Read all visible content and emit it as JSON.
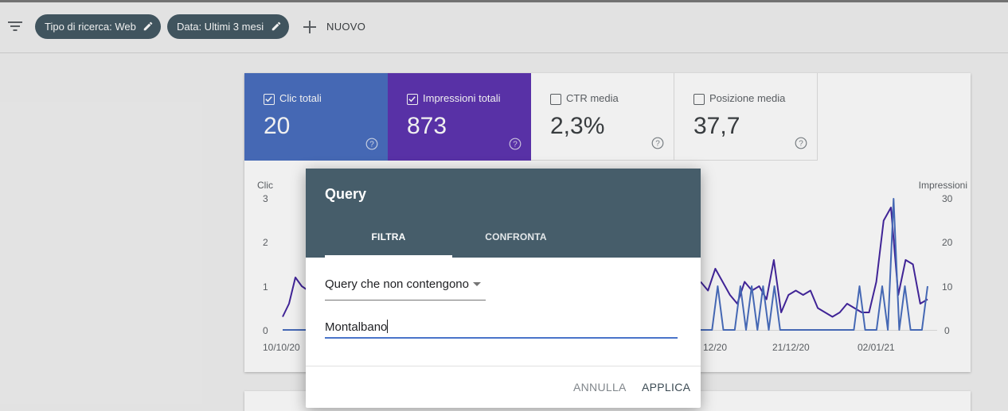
{
  "filter_bar": {
    "chips": [
      {
        "label": "Tipo di ricerca: Web"
      },
      {
        "label": "Data: Ultimi 3 mesi"
      }
    ],
    "new_label": "NUOVO"
  },
  "metrics": [
    {
      "label": "Clic totali",
      "value": "20",
      "checked": true,
      "color": "#4a6fc0"
    },
    {
      "label": "Impressioni totali",
      "value": "873",
      "checked": true,
      "color": "#5e35b1"
    },
    {
      "label": "CTR media",
      "value": "2,3%",
      "checked": false
    },
    {
      "label": "Posizione media",
      "value": "37,7",
      "checked": false
    }
  ],
  "chart": {
    "left_axis_title": "Clic",
    "right_axis_title": "Impressioni",
    "left_ticks": [
      "3",
      "2",
      "1",
      "0"
    ],
    "right_ticks": [
      "30",
      "20",
      "10",
      "0"
    ],
    "x_ticks_left": [
      "10/10/20"
    ],
    "x_ticks_right": [
      "12/20",
      "21/12/20",
      "02/01/21"
    ]
  },
  "chart_data": {
    "type": "line",
    "ylim_left": [
      0,
      3
    ],
    "ylim_right": [
      0,
      30
    ],
    "series": [
      {
        "name": "Clic totali",
        "color": "#4a6fc0",
        "left_values": [
          0,
          0,
          0,
          0,
          0,
          0
        ],
        "right_values": [
          0,
          0,
          0,
          1,
          0,
          0,
          0,
          1,
          0,
          1,
          0,
          1,
          0,
          1,
          0,
          0,
          0,
          0,
          0,
          0,
          0,
          0,
          0,
          0,
          0,
          0,
          0,
          0,
          1,
          0,
          0,
          0,
          1,
          0,
          3,
          0,
          1,
          0,
          0,
          0,
          1
        ]
      },
      {
        "name": "Impressioni totali",
        "color": "#4527a0",
        "left_values": [
          3,
          6,
          12,
          10,
          9,
          11
        ],
        "right_values": [
          11,
          9,
          14,
          11,
          8,
          6,
          11,
          9,
          10,
          7,
          16,
          4,
          8,
          9,
          8,
          9,
          5,
          4,
          3,
          4,
          6,
          5,
          4,
          4,
          11,
          25,
          28,
          8,
          16,
          15,
          6,
          7
        ]
      }
    ]
  },
  "dialog": {
    "title": "Query",
    "tabs": [
      "FILTRA",
      "CONFRONTA"
    ],
    "select_value": "Query che non contengono",
    "input_value": "Montalbano",
    "cancel_label": "ANNULLA",
    "apply_label": "APPLICA"
  },
  "colors": {
    "chip_bg": "#455a64",
    "dialog_header": "#465d6a",
    "input_underline": "#4a74c9"
  }
}
